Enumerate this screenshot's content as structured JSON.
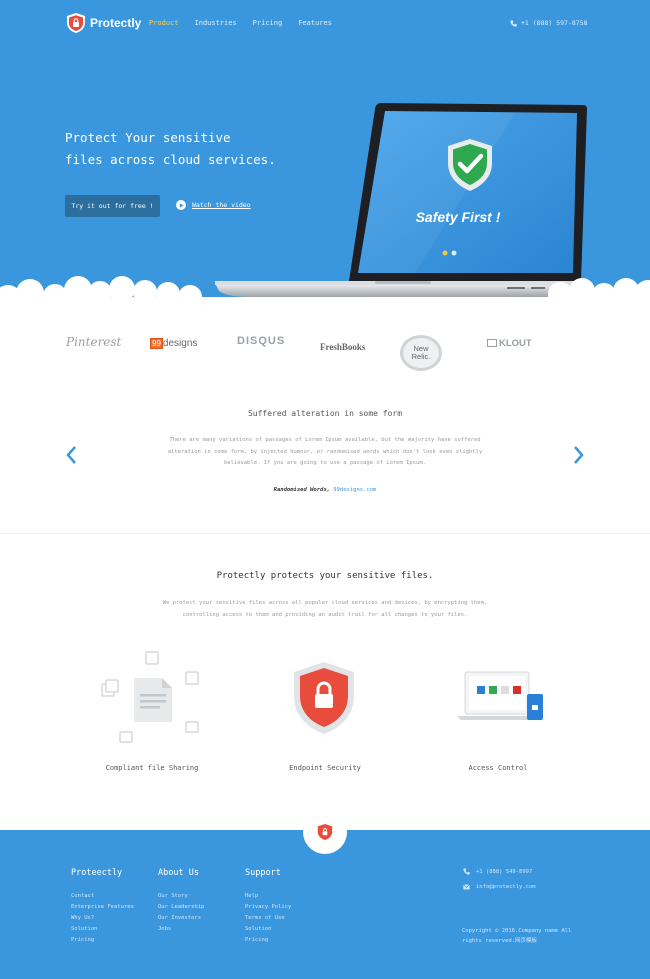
{
  "brand": {
    "name": "Protectly"
  },
  "nav": {
    "items": [
      "Product",
      "Industries",
      "Pricing",
      "Features"
    ],
    "phone": "+1 (888) 597-8758"
  },
  "hero": {
    "headline_line1": "Protect Your sensitive",
    "headline_line2": "files across cloud services.",
    "cta_label": "Try it out for free !",
    "watch_label": "Watch the video",
    "laptop_caption": "Safety First !"
  },
  "partners": [
    "Pinterest",
    "99designs",
    "DISQUS",
    "FreshBooks",
    "New Relic.",
    "KLOUT"
  ],
  "testimonial": {
    "title": "Suffered alteration in some form",
    "body": "There are many variations of passages of Lorem Ipsum available, but the majority have suffered alteration in some form, by injected humour, or randomised words which don't look even slightly believable. If you are going to use a passage of Lorem Ipsum.",
    "author_name": "Randomised Words,",
    "author_site": "99designs.com"
  },
  "features": {
    "title": "Protectly protects your sensitive files.",
    "body": "We protect your sensitive files across all popular cloud services and devices, by encrypting them, controlling access to them and providing an audit trail for all changes to your files.",
    "items": [
      {
        "label": "Compliant file Sharing",
        "icon": "document-icon"
      },
      {
        "label": "Endpoint Security",
        "icon": "shield-lock-icon"
      },
      {
        "label": "Access Control",
        "icon": "devices-icon"
      }
    ]
  },
  "footer": {
    "columns": [
      {
        "title": "Proteectly",
        "links": [
          "Contact",
          "Enterprise Features",
          "Why Us?",
          "Solution",
          "Pricing"
        ]
      },
      {
        "title": "About Us",
        "links": [
          "Our Story",
          "Our Leadership",
          "Our Investors",
          "Jobs"
        ]
      },
      {
        "title": "Support",
        "links": [
          "Help",
          "Privacy Policy",
          "Terms of Use",
          "Solution",
          "Pricing"
        ]
      }
    ],
    "phone": "+1 (888) 549-8997",
    "email": "info@protectly.com",
    "copyright_line1": "Copyright © 2016.Company name All",
    "copyright_line2": "rights reserved.网页模板"
  },
  "colors": {
    "primary": "#3a97de",
    "accent": "#ffd04a",
    "shield": "#e74c3c"
  }
}
